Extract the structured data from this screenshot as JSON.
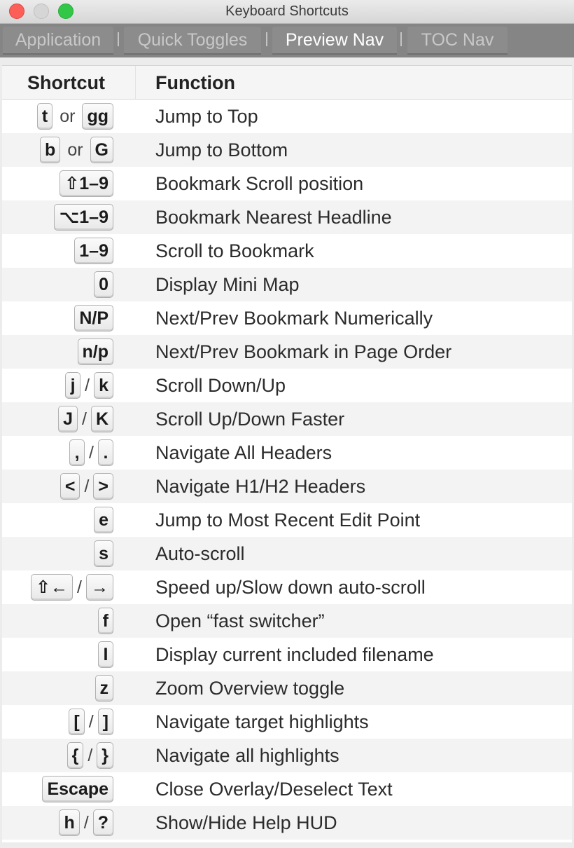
{
  "window": {
    "title": "Keyboard Shortcuts"
  },
  "tabs": [
    {
      "label": "Application",
      "active": false
    },
    {
      "label": "Quick Toggles",
      "active": false
    },
    {
      "label": "Preview Nav",
      "active": true
    },
    {
      "label": "TOC Nav",
      "active": false
    }
  ],
  "table": {
    "headers": {
      "shortcut": "Shortcut",
      "function": "Function"
    },
    "rows": [
      {
        "keys": [
          "t",
          "gg"
        ],
        "sep": "or",
        "function": "Jump to Top"
      },
      {
        "keys": [
          "b",
          "G"
        ],
        "sep": "or",
        "function": "Jump to Bottom"
      },
      {
        "keys": [
          "⇧1–9"
        ],
        "sep": "",
        "function": "Bookmark Scroll position"
      },
      {
        "keys": [
          "⌥1–9"
        ],
        "sep": "",
        "function": "Bookmark Nearest Headline"
      },
      {
        "keys": [
          "1–9"
        ],
        "sep": "",
        "function": "Scroll to Bookmark"
      },
      {
        "keys": [
          "0"
        ],
        "sep": "",
        "function": "Display Mini Map"
      },
      {
        "keys": [
          "N/P"
        ],
        "sep": "",
        "function": "Next/Prev Bookmark Numerically"
      },
      {
        "keys": [
          "n/p"
        ],
        "sep": "",
        "function": "Next/Prev Bookmark in Page Order"
      },
      {
        "keys": [
          "j",
          "k"
        ],
        "sep": "/",
        "function": "Scroll Down/Up"
      },
      {
        "keys": [
          "J",
          "K"
        ],
        "sep": "/",
        "function": "Scroll Up/Down Faster"
      },
      {
        "keys": [
          ",",
          "."
        ],
        "sep": "/",
        "function": "Navigate All Headers"
      },
      {
        "keys": [
          "<",
          ">"
        ],
        "sep": "/",
        "function": "Navigate H1/H2 Headers"
      },
      {
        "keys": [
          "e"
        ],
        "sep": "",
        "function": "Jump to Most Recent Edit Point"
      },
      {
        "keys": [
          "s"
        ],
        "sep": "",
        "function": "Auto-scroll"
      },
      {
        "keys": [
          "⇧←",
          "→"
        ],
        "sep": "/",
        "function": "Speed up/Slow down auto-scroll"
      },
      {
        "keys": [
          "f"
        ],
        "sep": "",
        "function": "Open “fast switcher”"
      },
      {
        "keys": [
          "I"
        ],
        "sep": "",
        "function": "Display current included filename"
      },
      {
        "keys": [
          "z"
        ],
        "sep": "",
        "function": "Zoom Overview toggle"
      },
      {
        "keys": [
          "[",
          "]"
        ],
        "sep": "/",
        "function": "Navigate target highlights"
      },
      {
        "keys": [
          "{",
          "}"
        ],
        "sep": "/",
        "function": "Navigate all highlights"
      },
      {
        "keys": [
          "Escape"
        ],
        "sep": "",
        "function": "Close Overlay/Deselect Text"
      },
      {
        "keys": [
          "h",
          "?"
        ],
        "sep": "/",
        "function": "Show/Hide Help HUD"
      }
    ]
  },
  "colors": {
    "close": "#fc5f57",
    "minimize": "#d6d6d6",
    "zoom": "#33c748",
    "tabbar": "#858585",
    "row_alt": "#f3f3f3"
  }
}
